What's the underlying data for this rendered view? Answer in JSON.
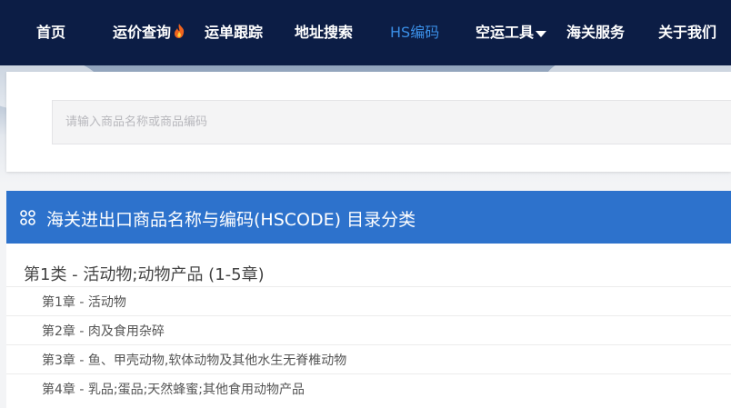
{
  "nav": {
    "items": [
      {
        "label": "首页"
      },
      {
        "label": "运价查询",
        "icon": "flame-icon"
      },
      {
        "label": "运单跟踪"
      },
      {
        "label": "地址搜索"
      },
      {
        "label": "HS编码",
        "active": true
      },
      {
        "label": "空运工具",
        "icon": "caret-down-icon"
      },
      {
        "label": "海关服务"
      },
      {
        "label": "关于我们"
      }
    ],
    "colors": {
      "background": "#0c1d45",
      "active": "#3a8ee6",
      "hot": "#f0641e"
    }
  },
  "search": {
    "placeholder": "请输入商品名称或商品编码",
    "value": ""
  },
  "catalog": {
    "header": "海关进出口商品名称与编码(HSCODE) 目录分类",
    "header_icon": "grid-icon",
    "header_color": "#2d72cc",
    "sections": [
      {
        "title": "第1类 - 活动物;动物产品 (1-5章)",
        "chapters": [
          {
            "label": "第1章 - 活动物"
          },
          {
            "label": "第2章 - 肉及食用杂碎"
          },
          {
            "label": "第3章 - 鱼、甲壳动物,软体动物及其他水生无脊椎动物"
          },
          {
            "label": "第4章 - 乳品;蛋品;天然蜂蜜;其他食用动物产品"
          }
        ]
      }
    ]
  }
}
